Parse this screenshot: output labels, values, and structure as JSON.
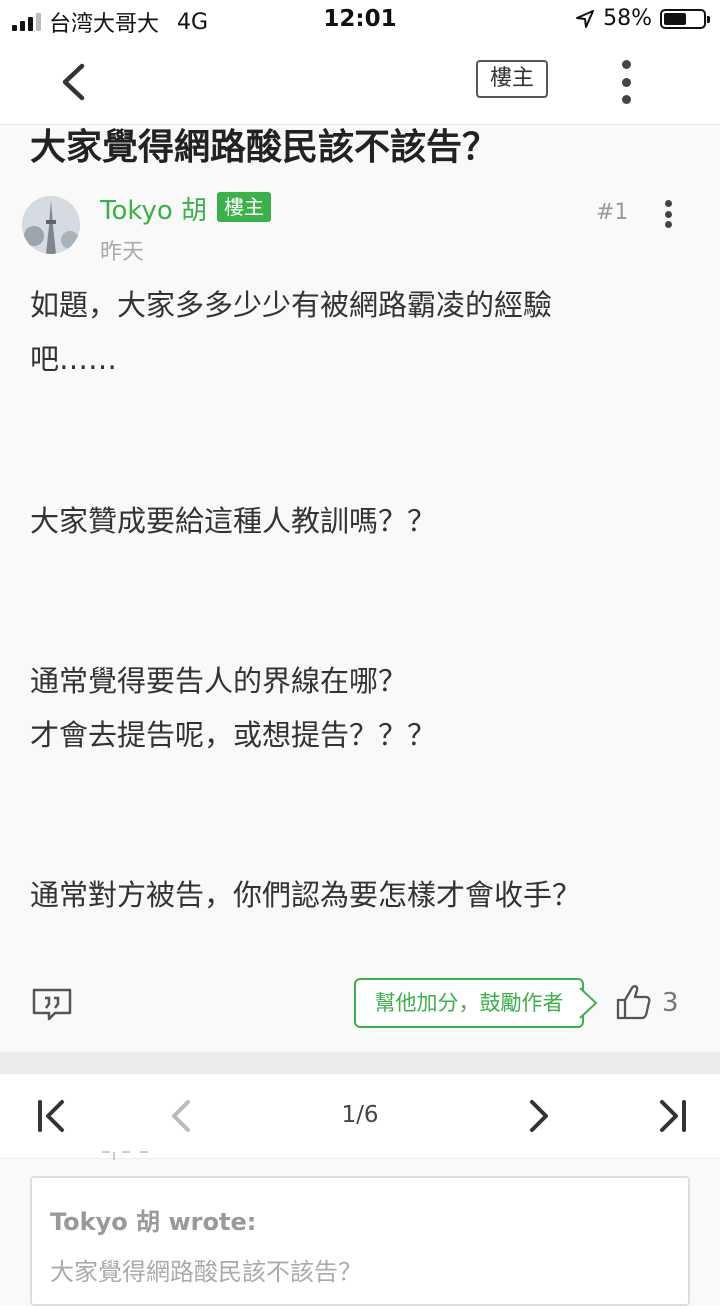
{
  "status_bar": {
    "carrier": "台湾大哥大",
    "network": "4G",
    "time": "12:01",
    "battery_percent_text": "58%",
    "battery_level": 0.58
  },
  "nav": {
    "owner_button": "樓主",
    "back_icon": "chevron-left-icon",
    "more_icon": "vertical-dots-icon"
  },
  "thread": {
    "title": "大家覺得網路酸民該不該告？"
  },
  "post": {
    "author": "Tokyo 胡",
    "owner_tag": "樓主",
    "time": "昨天",
    "number": "#1",
    "lines": [
      "如題，大家多多少少有被網路霸凌的經驗",
      "吧……",
      "大家贊成要給這種人教訓嗎？？",
      "通常覺得要告人的界線在哪？",
      "才會去提告呢，或想提告？？？",
      "通常對方被告，你們認為要怎樣才會收手？"
    ],
    "praise_button": "幫他加分，鼓勵作者",
    "like_count": "3"
  },
  "pagination": {
    "page_text": "1/6"
  },
  "quote": {
    "author": "Tokyo 胡 wrote:",
    "text": "大家覺得網路酸民該不該告？"
  },
  "colors": {
    "accent_green": "#3bb14a",
    "text": "#333333",
    "background": "#f9f9f9"
  }
}
